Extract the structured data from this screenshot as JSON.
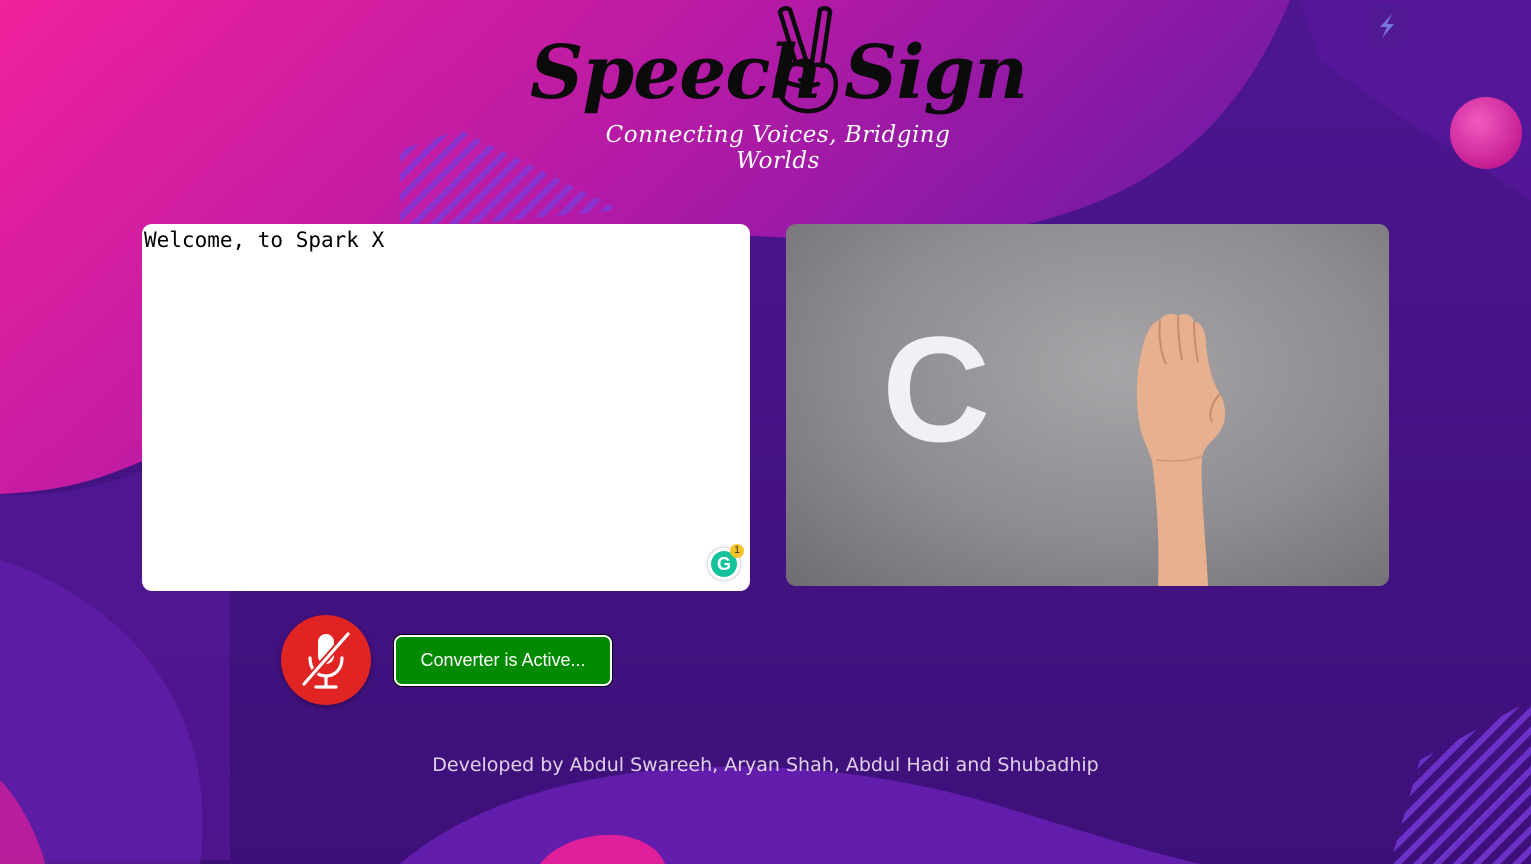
{
  "header": {
    "logo_word_left": "Speech",
    "logo_word_right": "Sign",
    "tagline": "Connecting Voices, Bridging Worlds"
  },
  "text_panel": {
    "content": "Welcome, to Spark X",
    "grammar_badge_letter": "G",
    "grammar_badge_count": "1"
  },
  "sign_panel": {
    "letter": "C"
  },
  "controls": {
    "mic_icon": "mic-off-icon",
    "status_label": "Converter is Active..."
  },
  "footer": {
    "credit": "Developed by Abdul Swareeh, Aryan Shah, Abdul Hadi and Shubadhip"
  },
  "colors": {
    "mic_button": "#e02424",
    "status_button": "#008a00",
    "background_pink": "#f0219c",
    "background_purple": "#4a1486"
  }
}
